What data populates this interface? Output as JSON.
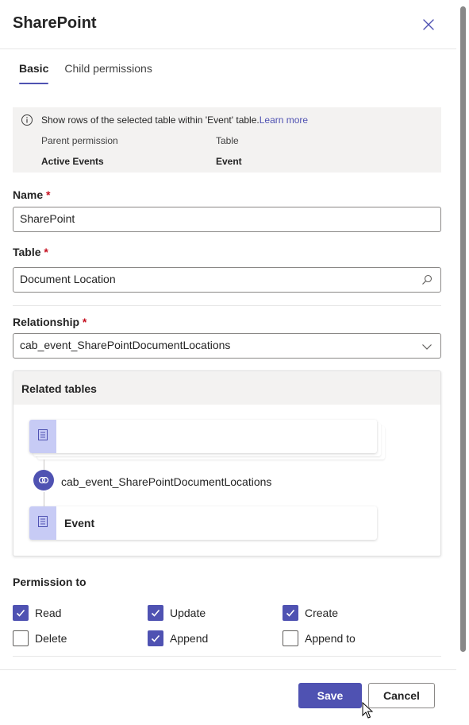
{
  "panel": {
    "title": "SharePoint",
    "close_icon": "close-icon"
  },
  "tabs": [
    {
      "label": "Basic",
      "active": true
    },
    {
      "label": "Child permissions",
      "active": false
    }
  ],
  "info": {
    "icon": "info-icon",
    "message": "Show rows of the selected table within 'Event' table.",
    "link": "Learn more",
    "parent_permission_label": "Parent permission",
    "table_label": "Table",
    "parent_permission_value": "Active Events",
    "table_value": "Event"
  },
  "fields": {
    "name": {
      "label": "Name",
      "required": "*",
      "value": "SharePoint"
    },
    "table": {
      "label": "Table",
      "required": "*",
      "value": "Document Location",
      "icon": "search-icon"
    },
    "relationship": {
      "label": "Relationship",
      "required": "*",
      "value": "cab_event_SharePointDocumentLocations",
      "icon": "chevron-down-icon"
    }
  },
  "related_tables": {
    "heading": "Related tables",
    "top_card_text": "",
    "relationship_name": "cab_event_SharePointDocumentLocations",
    "bottom_card_text": "Event"
  },
  "permissions": {
    "heading": "Permission to",
    "items": [
      {
        "label": "Read",
        "checked": true
      },
      {
        "label": "Update",
        "checked": true
      },
      {
        "label": "Create",
        "checked": true
      },
      {
        "label": "Delete",
        "checked": false
      },
      {
        "label": "Append",
        "checked": true
      },
      {
        "label": "Append to",
        "checked": false
      }
    ]
  },
  "footer": {
    "save_label": "Save",
    "cancel_label": "Cancel"
  },
  "colors": {
    "accent": "#4f52b2",
    "required": "#c50f1f",
    "info_bg": "#f3f2f1",
    "card_accent": "#c7cbf5"
  }
}
